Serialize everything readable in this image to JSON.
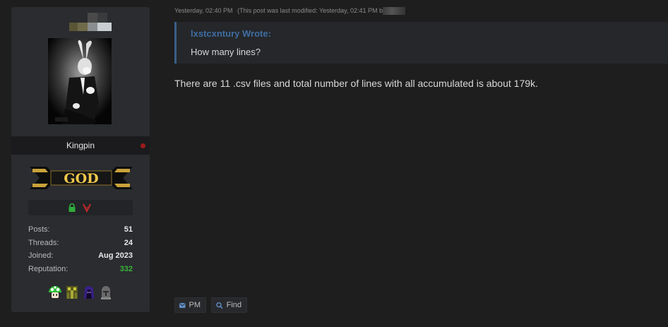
{
  "user": {
    "username": "Kingpin",
    "rank_badge": "GOD",
    "status": "offline",
    "stats": [
      {
        "label": "Posts:",
        "value": "51"
      },
      {
        "label": "Threads:",
        "value": "24"
      },
      {
        "label": "Joined:",
        "value": "Aug 2023"
      },
      {
        "label": "Reputation:",
        "value": "332"
      }
    ],
    "award_icons": [
      "mushroom-award-icon",
      "robot-award-icon",
      "hooded-figure-award-icon",
      "knight-helmet-award-icon"
    ]
  },
  "post": {
    "timestamp": "Yesterday, 02:40 PM",
    "edited_note": "(This post was last modified: Yesterday, 02:41 PM b",
    "quote": {
      "author_line": "lxstcxntury Wrote:",
      "text": "How many lines?"
    },
    "body": "There are 11 .csv files and total number of lines with all accumulated is about 179k."
  },
  "buttons": {
    "pm_label": "PM",
    "find_label": "Find"
  },
  "colors": {
    "background": "#1e1e1e",
    "card": "#2a2c2f",
    "quote_author": "#3f6ea3",
    "reputation": "#3bb33b",
    "status_offline": "#9b1c1c"
  }
}
